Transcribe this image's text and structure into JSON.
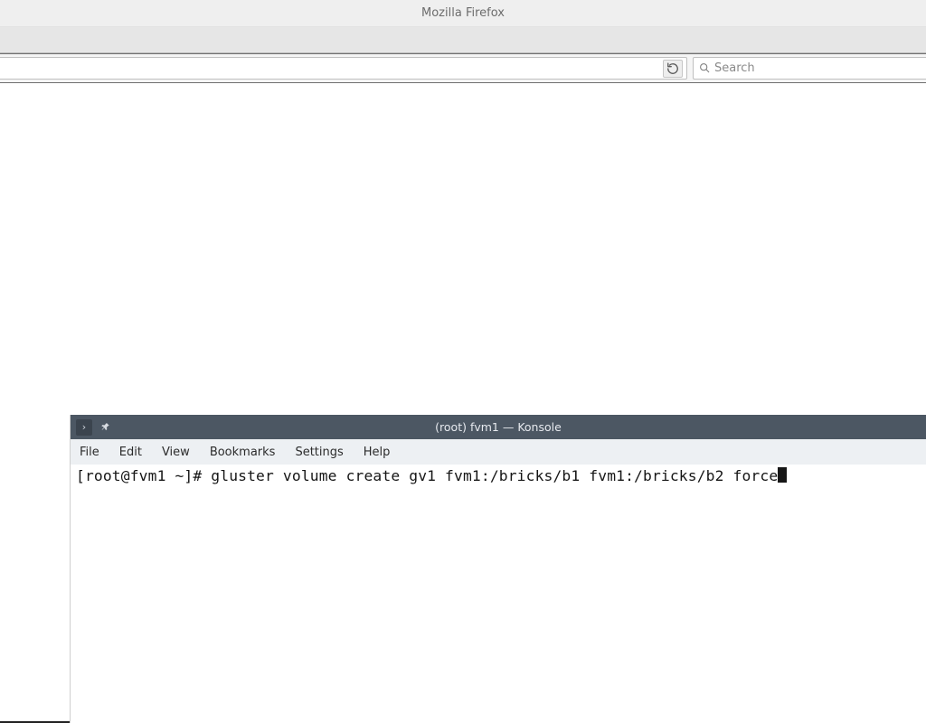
{
  "firefox": {
    "window_title": "Mozilla Firefox",
    "reload_glyph": "↻",
    "search_placeholder": "Search"
  },
  "konsole": {
    "window_title": "(root) fvm1 — Konsole",
    "icons": {
      "expand_glyph": "›",
      "pin_glyph": "📌"
    },
    "menu": {
      "file": "File",
      "edit": "Edit",
      "view": "View",
      "bookmarks": "Bookmarks",
      "settings": "Settings",
      "help": "Help"
    },
    "terminal": {
      "prompt": "[root@fvm1 ~]# ",
      "command": "gluster volume create gv1 fvm1:/bricks/b1 fvm1:/bricks/b2 force"
    }
  }
}
